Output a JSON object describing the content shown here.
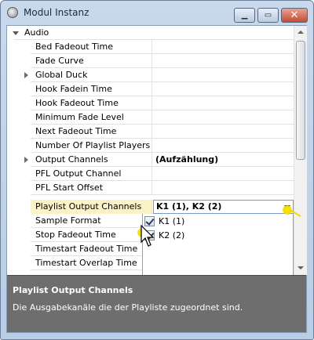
{
  "window": {
    "title": "Modul Instanz"
  },
  "grid": {
    "category": "Audio",
    "properties": [
      {
        "name": "Bed Fadeout Time",
        "value": ""
      },
      {
        "name": "Fade Curve",
        "value": ""
      },
      {
        "name": "Global Duck",
        "value": ""
      },
      {
        "name": "Hook Fadein Time",
        "value": ""
      },
      {
        "name": "Hook Fadeout Time",
        "value": ""
      },
      {
        "name": "Minimum Fade Level",
        "value": ""
      },
      {
        "name": "Next Fadeout Time",
        "value": ""
      },
      {
        "name": "Number Of Playlist Players",
        "value": ""
      },
      {
        "name": "Output Channels",
        "value": "(Aufzählung)"
      },
      {
        "name": "PFL Output Channel",
        "value": ""
      },
      {
        "name": "PFL Start Offset",
        "value": ""
      },
      {
        "name": "Playlist Output Channels",
        "value": "K1 (1), K2 (2)"
      },
      {
        "name": "Sample Format",
        "value": ""
      },
      {
        "name": "Stop Fadeout Time",
        "value": ""
      },
      {
        "name": "Timestart Fadeout Time",
        "value": ""
      },
      {
        "name": "Timestart Overlap Time",
        "value": ""
      }
    ],
    "dropdown_options": [
      {
        "label": "K1 (1)",
        "checked": true
      },
      {
        "label": "K2 (2)",
        "checked": true
      }
    ]
  },
  "help": {
    "title": "Playlist Output Channels",
    "description": "Die Ausgabekanäle die der Playliste zugeordnet sind."
  }
}
